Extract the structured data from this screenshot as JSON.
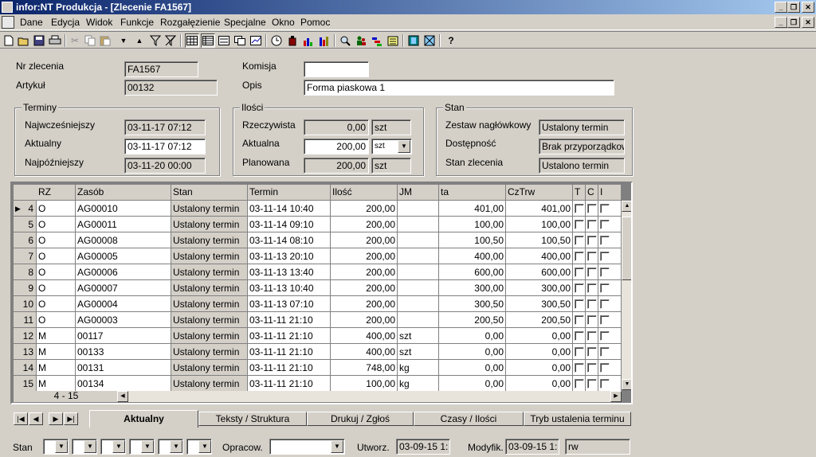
{
  "window": {
    "title": "infor:NT Produkcja - [Zlecenie FA1567]"
  },
  "menu": [
    "Dane",
    "Edycja",
    "Widok",
    "Funkcje",
    "Rozgałęzienie",
    "Specjalne",
    "Okno",
    "Pomoc"
  ],
  "toolbar": {
    "icons": [
      "new-icon",
      "open-icon",
      "save-icon",
      "print-icon",
      "cut-icon",
      "copy-icon",
      "paste-icon",
      "dropdown-icon",
      "sort-up-icon",
      "filter-icon",
      "clear-filter-icon",
      "grid-view-icon",
      "table-view-icon",
      "form-view-icon",
      "multi-view-icon",
      "chart-icon",
      "clock-icon",
      "bottle-icon",
      "bar-chart-icon",
      "column-chart-icon",
      "search-icon",
      "people-icon",
      "gantt-icon",
      "list-icon",
      "film-icon",
      "network-icon",
      "help-icon"
    ],
    "help_glyph": "?"
  },
  "header": {
    "nr_label": "Nr zlecenia",
    "nr_value": "FA1567",
    "artykul_label": "Artykuł",
    "artykul_value": "00132",
    "komisja_label": "Komisja",
    "komisja_value": "",
    "opis_label": "Opis",
    "opis_value": "Forma piaskowa 1"
  },
  "terminy": {
    "title": "Terminy",
    "rows": [
      {
        "label": "Najwcześniejszy",
        "value": "03-11-17 07:12"
      },
      {
        "label": "Aktualny",
        "value": "03-11-17 07:12"
      },
      {
        "label": "Najpóźniejszy",
        "value": "03-11-20 00:00"
      }
    ]
  },
  "ilosci": {
    "title": "Ilości",
    "rows": [
      {
        "label": "Rzeczywista",
        "value": "0,00",
        "unit": "szt"
      },
      {
        "label": "Aktualna",
        "value": "200,00",
        "unit": "szt"
      },
      {
        "label": "Planowana",
        "value": "200,00",
        "unit": "szt"
      }
    ]
  },
  "stan": {
    "title": "Stan",
    "rows": [
      {
        "label": "Zestaw nagłówkowy",
        "value": "Ustalony termin"
      },
      {
        "label": "Dostępność",
        "value": "Brak przyporządkow"
      },
      {
        "label": "Stan zlecenia",
        "value": "Ustalono termin"
      }
    ]
  },
  "grid": {
    "columns": [
      "RZ",
      "Zasób",
      "Stan",
      "Termin",
      "Ilość",
      "JM",
      "ta",
      "CzTrw",
      "T",
      "C",
      "I"
    ],
    "rows": [
      {
        "n": "4",
        "rz": "O",
        "zasob": "AG00010",
        "stan": "Ustalony termin",
        "termin": "03-11-14 10:40",
        "ilosc": "200,00",
        "jm": "",
        "ta": "401,00",
        "cztrw": "401,00",
        "current": true
      },
      {
        "n": "5",
        "rz": "O",
        "zasob": "AG00011",
        "stan": "Ustalony termin",
        "termin": "03-11-14 09:10",
        "ilosc": "200,00",
        "jm": "",
        "ta": "100,00",
        "cztrw": "100,00"
      },
      {
        "n": "6",
        "rz": "O",
        "zasob": "AG00008",
        "stan": "Ustalony termin",
        "termin": "03-11-14 08:10",
        "ilosc": "200,00",
        "jm": "",
        "ta": "100,50",
        "cztrw": "100,50"
      },
      {
        "n": "7",
        "rz": "O",
        "zasob": "AG00005",
        "stan": "Ustalony termin",
        "termin": "03-11-13 20:10",
        "ilosc": "200,00",
        "jm": "",
        "ta": "400,00",
        "cztrw": "400,00"
      },
      {
        "n": "8",
        "rz": "O",
        "zasob": "AG00006",
        "stan": "Ustalony termin",
        "termin": "03-11-13 13:40",
        "ilosc": "200,00",
        "jm": "",
        "ta": "600,00",
        "cztrw": "600,00"
      },
      {
        "n": "9",
        "rz": "O",
        "zasob": "AG00007",
        "stan": "Ustalony termin",
        "termin": "03-11-13 10:40",
        "ilosc": "200,00",
        "jm": "",
        "ta": "300,00",
        "cztrw": "300,00"
      },
      {
        "n": "10",
        "rz": "O",
        "zasob": "AG00004",
        "stan": "Ustalony termin",
        "termin": "03-11-13 07:10",
        "ilosc": "200,00",
        "jm": "",
        "ta": "300,50",
        "cztrw": "300,50"
      },
      {
        "n": "11",
        "rz": "O",
        "zasob": "AG00003",
        "stan": "Ustalony termin",
        "termin": "03-11-11 21:10",
        "ilosc": "200,00",
        "jm": "",
        "ta": "200,50",
        "cztrw": "200,50"
      },
      {
        "n": "12",
        "rz": "M",
        "zasob": "00117",
        "stan": "Ustalony termin",
        "termin": "03-11-11 21:10",
        "ilosc": "400,00",
        "jm": "szt",
        "ta": "0,00",
        "cztrw": "0,00"
      },
      {
        "n": "13",
        "rz": "M",
        "zasob": "00133",
        "stan": "Ustalony termin",
        "termin": "03-11-11 21:10",
        "ilosc": "400,00",
        "jm": "szt",
        "ta": "0,00",
        "cztrw": "0,00"
      },
      {
        "n": "14",
        "rz": "M",
        "zasob": "00131",
        "stan": "Ustalony termin",
        "termin": "03-11-11 21:10",
        "ilosc": "748,00",
        "jm": "kg",
        "ta": "0,00",
        "cztrw": "0,00"
      },
      {
        "n": "15",
        "rz": "M",
        "zasob": "00134",
        "stan": "Ustalony termin",
        "termin": "03-11-11 21:10",
        "ilosc": "100,00",
        "jm": "kg",
        "ta": "0,00",
        "cztrw": "0,00"
      }
    ],
    "range": "4 - 15"
  },
  "tabs": [
    "Aktualny",
    "Teksty / Struktura",
    "Drukuj / Zgłoś",
    "Czasy / Ilości",
    "Tryb ustalenia terminu"
  ],
  "footer": {
    "stan_label": "Stan",
    "opracow_label": "Opracow.",
    "utworz_label": "Utworz.",
    "utworz_value": "03-09-15 1:",
    "modyfik_label": "Modyfik.",
    "modyfik_value": "03-09-15 1:",
    "user": "rw"
  }
}
